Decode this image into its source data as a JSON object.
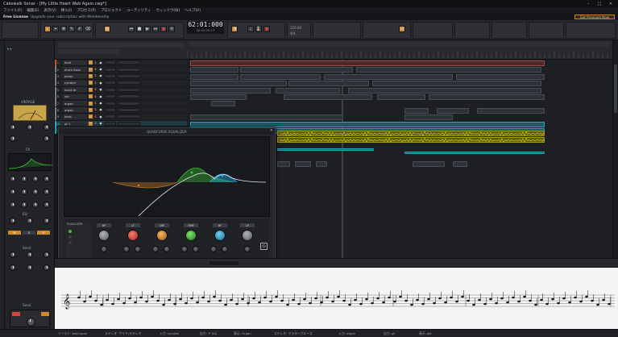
{
  "window": {
    "title": "Cakewalk Sonar - [My Little Heart Web Again.cwp*]",
    "controls": [
      "–",
      "□",
      "✕"
    ]
  },
  "menu": [
    "ファイル(F)",
    "編集(E)",
    "表示(V)",
    "挿入(I)",
    "プロセス(P)",
    "プロジェクト",
    "ユーティリティ",
    "ウィンドウ(W)",
    "ヘルプ(H)"
  ],
  "notice": {
    "title": "Free License",
    "text": "Upgrade your subscription with Membership",
    "button": "Get Premium Now"
  },
  "transport": {
    "time": "62:01:000",
    "subtime": "00:01:45.17",
    "tempo": "120.00",
    "meter": "4/4"
  },
  "tracks": [
    {
      "num": "1",
      "name": "lead",
      "color": "#c9562f"
    },
    {
      "num": "2",
      "name": "drum bass",
      "color": "#7a7f88"
    },
    {
      "num": "3",
      "name": "piano",
      "color": "#7a7f88"
    },
    {
      "num": "4",
      "name": "cymbal",
      "color": "#7a7f88"
    },
    {
      "num": "5",
      "name": "hand dr",
      "color": "#7a7f88"
    },
    {
      "num": "6",
      "name": "vib",
      "color": "#7a7f88"
    },
    {
      "num": "7",
      "name": "organ",
      "color": "#7a7f88"
    },
    {
      "num": "8",
      "name": "organ",
      "color": "#7a7f88"
    },
    {
      "num": "9",
      "name": "bass",
      "color": "#7a7f88"
    },
    {
      "num": "10",
      "name": "gt 1",
      "color": "#2aa4b8"
    },
    {
      "num": "11",
      "name": "gtr2",
      "color": "#2aa4b8"
    }
  ],
  "eq": {
    "title": "QUADCURVE EQUALIZER",
    "mode_label": "EQUALIZER",
    "bands": [
      {
        "label": "HP",
        "color": "#8a8e95"
      },
      {
        "label": "LF",
        "color": "#d9443a"
      },
      {
        "label": "LMF",
        "color": "#e08a2a"
      },
      {
        "label": "HMF",
        "color": "#3fbf3a"
      },
      {
        "label": "HF",
        "color": "#2aa4d8"
      },
      {
        "label": "LP",
        "color": "#8a8e95"
      }
    ]
  },
  "inspector": {
    "labels": [
      "VINTAGE",
      "FX",
      "EQ",
      "Send",
      "Send",
      "M",
      "S",
      "R"
    ]
  },
  "statusbar": [
    "ソースト: lead open",
    "ステレオ: サイド/ステレオ",
    "入力: cymbal",
    "出力: ドラム",
    "表示: Organ",
    "ステレオ: マスタープルース",
    "入力: organ",
    "出力: gt",
    "表示: gtr"
  ]
}
